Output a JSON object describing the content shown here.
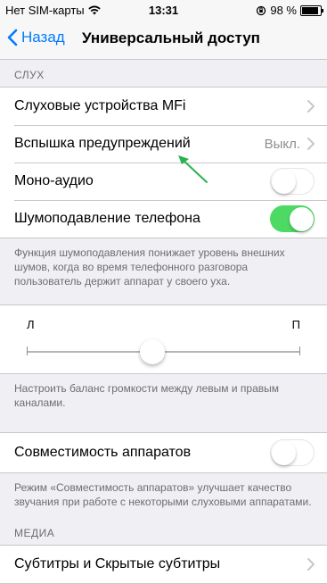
{
  "status": {
    "carrier": "Нет SIM-карты",
    "time": "13:31",
    "battery": "98 %",
    "battery_level": 0.98
  },
  "nav": {
    "back_label": "Назад",
    "title": "Универсальный доступ"
  },
  "hearing": {
    "header": "СЛУХ",
    "rows": [
      {
        "label": "Слуховые устройства MFi"
      },
      {
        "label": "Вспышка предупреждений",
        "value": "Выкл."
      },
      {
        "label": "Моно-аудио",
        "on": false
      },
      {
        "label": "Шумоподавление телефона",
        "on": true
      }
    ],
    "footer": "Функция шумоподавления понижает уровень внешних шумов, когда во время телефонного разговора пользователь держит аппарат у своего уха."
  },
  "balance": {
    "left_label": "Л",
    "right_label": "П",
    "value": 0.5,
    "footer": "Настроить баланс громкости между левым и правым каналами."
  },
  "compat": {
    "label": "Совместимость аппаратов",
    "on": false,
    "footer": "Режим «Совместимость аппаратов» улучшает качество звучания при работе с некоторыми слуховыми аппаратами."
  },
  "media": {
    "header": "МЕДИА",
    "rows": [
      {
        "label": "Субтитры и Скрытые субтитры"
      }
    ]
  },
  "colors": {
    "accent": "#007aff",
    "toggle_on": "#4cd964",
    "annotation_arrow": "#2bb24c"
  }
}
